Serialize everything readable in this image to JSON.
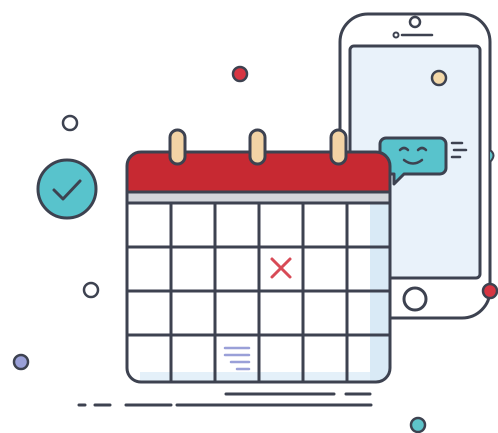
{
  "illustration": {
    "subject": "calendar-and-phone-notification",
    "calendar": {
      "columns": 6,
      "rows": 4,
      "rings": 3,
      "marked_cell": "x-mark",
      "note_cell": "lines-icon"
    },
    "phone": {
      "notification": "chat-bubble-smiley"
    },
    "badge": "check-mark"
  },
  "colors": {
    "outline": "#3d4250",
    "calendar_header": "#c72932",
    "calendar_header_band": "#d3d6db",
    "calendar_body": "#ffffff",
    "calendar_shade": "#d9eaf6",
    "phone_screen": "#e9f2fa",
    "phone_body": "#ffffff",
    "ring_fill": "#f2d3a5",
    "accent_teal": "#58c3cc",
    "x_mark": "#d84a56",
    "dot_red": "#d73542",
    "dot_cream": "#f3d8a8",
    "dot_purple": "#9aa0d8",
    "dot_teal": "#5ec3c9"
  }
}
